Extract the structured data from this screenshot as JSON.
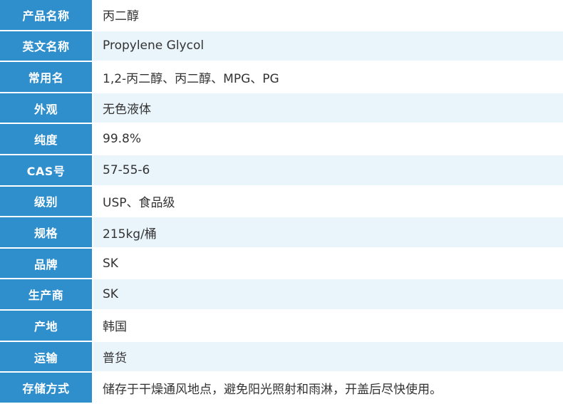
{
  "rows": [
    {
      "label": "产品名称",
      "value": "丙二醇"
    },
    {
      "label": "英文名称",
      "value": "Propylene Glycol"
    },
    {
      "label": "常用名",
      "value": "1,2-丙二醇、丙二醇、MPG、PG"
    },
    {
      "label": "外观",
      "value": "无色液体"
    },
    {
      "label": "纯度",
      "value": "99.8%"
    },
    {
      "label": "CAS号",
      "value": "57-55-6"
    },
    {
      "label": "级别",
      "value": "USP、食品级"
    },
    {
      "label": "规格",
      "value": "215kg/桶"
    },
    {
      "label": "品牌",
      "value": "SK"
    },
    {
      "label": "生产商",
      "value": "SK"
    },
    {
      "label": "产地",
      "value": "韩国"
    },
    {
      "label": "运输",
      "value": "普货"
    },
    {
      "label": "存储方式",
      "value": "储存于干燥通风地点，避免阳光照射和雨淋，开盖后尽快使用。"
    }
  ],
  "colors": {
    "label_background": "#2f8fcd",
    "label_text": "#ffffff",
    "row_alt_background": "#eaf4fb",
    "value_text": "#333333"
  }
}
